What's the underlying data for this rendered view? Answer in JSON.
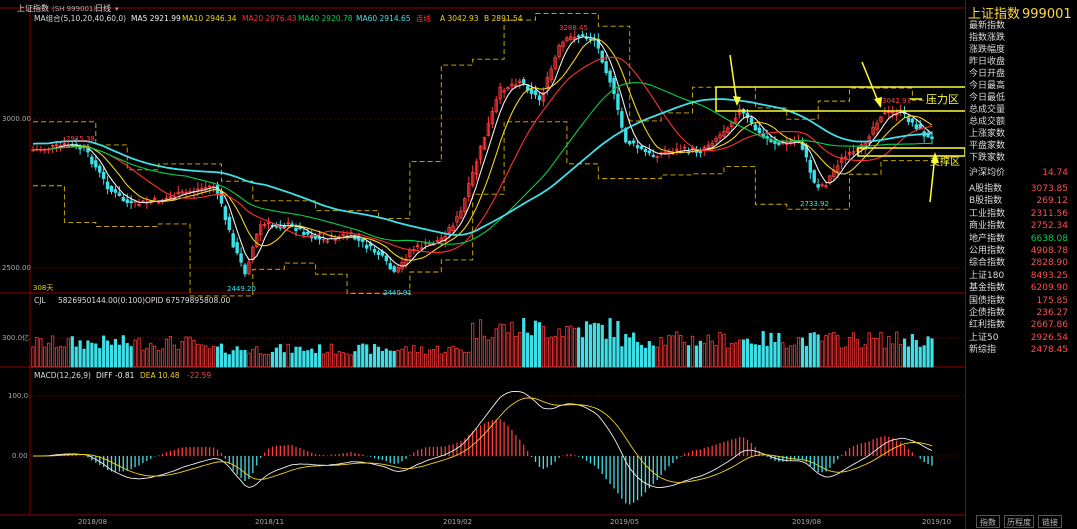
{
  "window": {
    "title": "上证指数",
    "code": "(SH 999001)",
    "period": "日线"
  },
  "legend_ma": {
    "title": "MA组合(5,10,20,40,60,0)",
    "ma5": "MA5 2921.99",
    "ma10": "MA10 2946.34",
    "ma20": "MA20 2976.43",
    "ma40": "MA40 2920.78",
    "ma60": "MA60 2914.65",
    "lx": "连线",
    "a": "A 3042.93",
    "b": "B 2891.54"
  },
  "legend_vol": {
    "cjl": "CJL",
    "v1": "5826950144.00(0:100)",
    "opid": "OPID 67579895808.00"
  },
  "legend_macd": {
    "title": "MACD(12,26,9)",
    "diff": "DIFF -0.81",
    "dea": "DEA 10.48",
    "m": "-22.59"
  },
  "price_axis": [
    "3000.00",
    "2500.00"
  ],
  "vol_axis": [
    "300.0亿"
  ],
  "macd_axis": [
    "100.0",
    "0.00"
  ],
  "date_axis": [
    "2018/08",
    "2018/11",
    "2019/02",
    "2019/05",
    "2019/08",
    "2019/10"
  ],
  "annotations": {
    "p1": "2915.38",
    "p2": "3288.45",
    "p3": "3042.93",
    "p4": "2733.92",
    "p5": "2449.20",
    "p6": "2440.91",
    "cycle": "308天",
    "pressure": "压力区",
    "support": "支撑区"
  },
  "side": {
    "title": "上证指数",
    "code": "999001",
    "labels": [
      "最新指数",
      "指数涨跌",
      "涨跌幅度",
      "昨日收盘",
      "今日开盘",
      "今日最高",
      "今日最低",
      "总成交量",
      "总成交额",
      "上涨家数",
      "平盘家数",
      "下跌家数"
    ],
    "sh_sz_ratio": {
      "label": "沪深均价",
      "value": "14.74"
    },
    "indices": [
      {
        "label": "A股指数",
        "value": "3073.85"
      },
      {
        "label": "B股指数",
        "value": "269.12"
      },
      {
        "label": "工业指数",
        "value": "2311.56"
      },
      {
        "label": "商业指数",
        "value": "2752.34"
      },
      {
        "label": "地产指数",
        "value": "6638.08",
        "color": "#00d050"
      },
      {
        "label": "公用指数",
        "value": "4908.78"
      },
      {
        "label": "综合指数",
        "value": "2828.90"
      },
      {
        "label": "上证180",
        "value": "8493.25"
      },
      {
        "label": "基金指数",
        "value": "6209.90"
      },
      {
        "label": "国债指数",
        "value": "175.85"
      },
      {
        "label": "企债指数",
        "value": "236.27"
      },
      {
        "label": "红利指数",
        "value": "2667.86"
      },
      {
        "label": "上证50",
        "value": "2926.54"
      },
      {
        "label": "新综指",
        "value": "2478.45"
      }
    ],
    "tabs": [
      "指数",
      "历程度",
      "链接"
    ]
  },
  "colors": {
    "up": "#ff3b3b",
    "down": "#3fe0e8",
    "ma5": "#f0f0f0",
    "ma10": "#f2d31a",
    "ma20": "#ff3030",
    "ma40": "#00d050",
    "ma60": "#3fe0e8",
    "band": "#d9b600",
    "annot": "#ffff33",
    "grid": "#5a0000"
  }
}
